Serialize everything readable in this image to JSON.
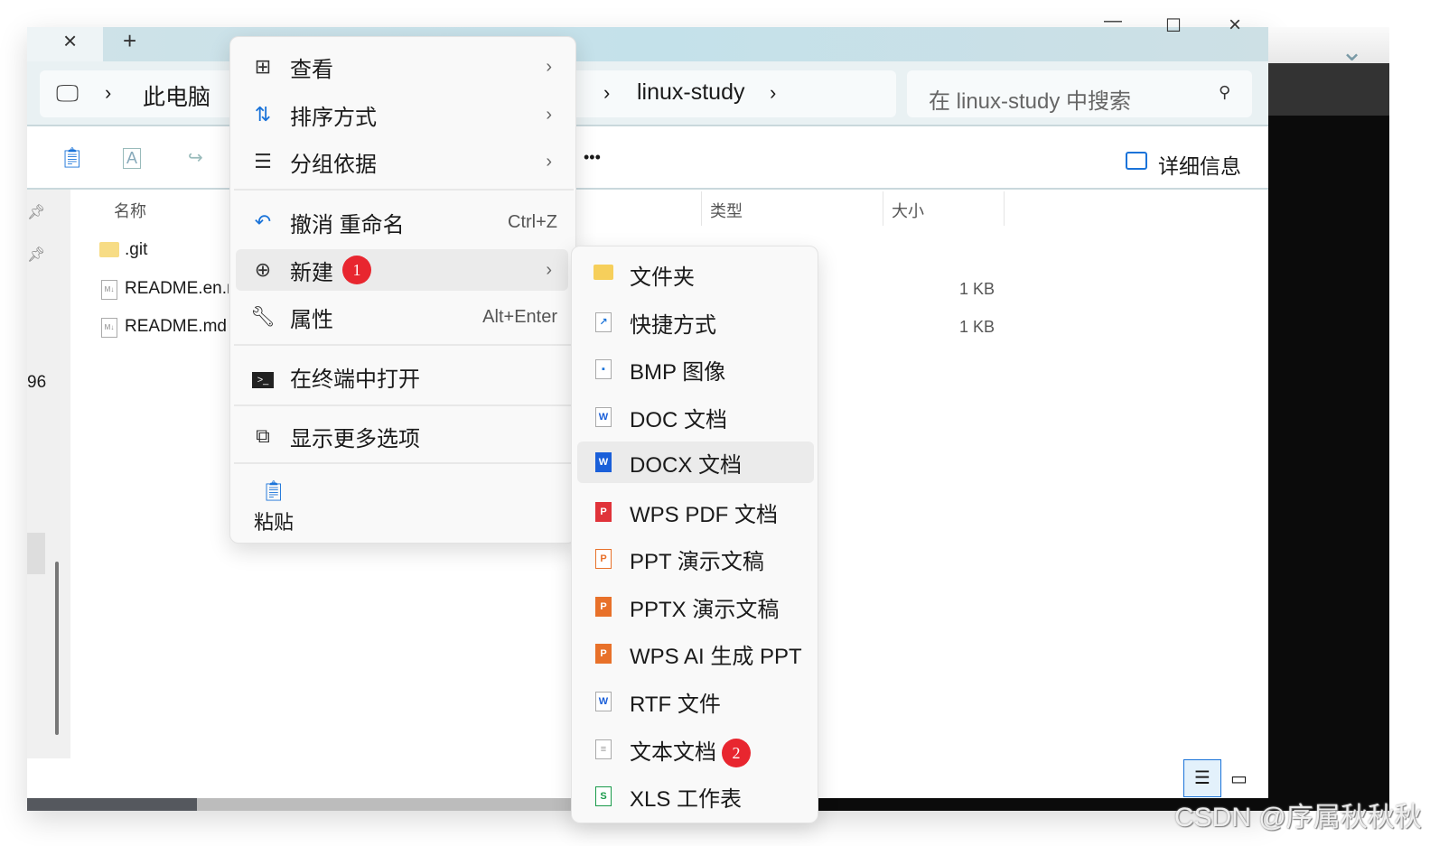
{
  "tabs": {
    "close": "×",
    "new": "+"
  },
  "window_controls": {
    "minimize": "—",
    "maximize": "☐",
    "close": "×"
  },
  "address": {
    "root": "此电脑",
    "current": "linux-study"
  },
  "search": {
    "placeholder": "在 linux-study 中搜索"
  },
  "toolbar": {
    "more": "•••",
    "details": "详细信息"
  },
  "columns": {
    "name": "名称",
    "type": "类型",
    "size": "大小"
  },
  "files": [
    {
      "name": ".git",
      "type": "",
      "size": ""
    },
    {
      "name": "README.en.md",
      "type": "",
      "size": "1 KB"
    },
    {
      "name": "README.md",
      "type": "",
      "size": "1 KB"
    }
  ],
  "nav_number": "96",
  "context_menu": {
    "view": "查看",
    "sort": "排序方式",
    "group": "分组依据",
    "undo": "撤消 重命名",
    "undo_shortcut": "Ctrl+Z",
    "new": "新建",
    "new_badge": "1",
    "properties": "属性",
    "properties_shortcut": "Alt+Enter",
    "terminal": "在终端中打开",
    "more_options": "显示更多选项",
    "paste": "粘贴"
  },
  "new_submenu": [
    {
      "label": "文件夹"
    },
    {
      "label": "快捷方式"
    },
    {
      "label": "BMP 图像"
    },
    {
      "label": "DOC 文档"
    },
    {
      "label": "DOCX 文档"
    },
    {
      "label": "WPS PDF 文档"
    },
    {
      "label": "PPT 演示文稿"
    },
    {
      "label": "PPTX 演示文稿"
    },
    {
      "label": "WPS AI 生成 PPT"
    },
    {
      "label": "RTF 文件"
    },
    {
      "label": "文本文档",
      "badge": "2"
    },
    {
      "label": "XLS 工作表"
    }
  ],
  "watermark": "CSDN @序属秋秋秋",
  "colors": {
    "accent": "#1a73d9",
    "badge": "#e8262f"
  }
}
